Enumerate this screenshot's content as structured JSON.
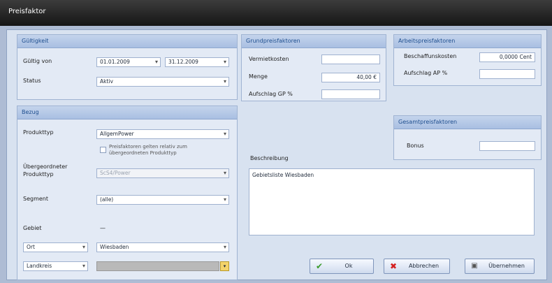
{
  "window": {
    "title": "Preisfaktor"
  },
  "gueltigkeit": {
    "header": "Gültigkeit",
    "gueltig_von_label": "Gültig von",
    "date_from": "01.01.2009",
    "date_to": "31.12.2009",
    "status_label": "Status",
    "status_value": "Aktiv"
  },
  "grundpreis": {
    "header": "Grundpreisfaktoren",
    "vermietkosten_label": "Vermietkosten",
    "vermietkosten_value": "",
    "menge_label": "Menge",
    "menge_value": "40,00 €",
    "aufschlag_label": "Aufschlag GP %",
    "aufschlag_value": ""
  },
  "arbeitspreis": {
    "header": "Arbeitspreisfaktoren",
    "beschaffung_label": "Beschaffunskosten",
    "beschaffung_value": "0,0000 Cent",
    "aufschlag_label": "Aufschlag AP %",
    "aufschlag_value": ""
  },
  "gesamtpreis": {
    "header": "Gesamtpreisfaktoren",
    "bonus_label": "Bonus",
    "bonus_value": ""
  },
  "bezug": {
    "header": "Bezug",
    "produkttyp_label": "Produkttyp",
    "produkttyp_value": "AllgemPower",
    "checkbox_label": "Preisfaktoren gelten relativ zum übergeordneten Produkttyp",
    "uebergeordnet_label": "Übergeordneter Produkttyp",
    "uebergeordnet_value": "ScS4/Power",
    "segment_label": "Segment",
    "segment_value": "(alle)",
    "gebiet_label": "Gebiet",
    "gebiet_value": "—",
    "ort_label": "Ort",
    "ort_value": "Wiesbaden",
    "landkreis_label": "Landkreis",
    "landkreis_value": ""
  },
  "beschreibung": {
    "label": "Beschreibung",
    "text": "Gebietsliste Wiesbaden"
  },
  "buttons": {
    "ok": "Ok",
    "abbrechen": "Abbrechen",
    "uebernehmen": "Übernehmen"
  },
  "colors": {
    "titlebar": "#222222",
    "panel_header": "#b3c6e6",
    "ok_icon": "#3a9a2a",
    "cancel_icon": "#d42020"
  }
}
